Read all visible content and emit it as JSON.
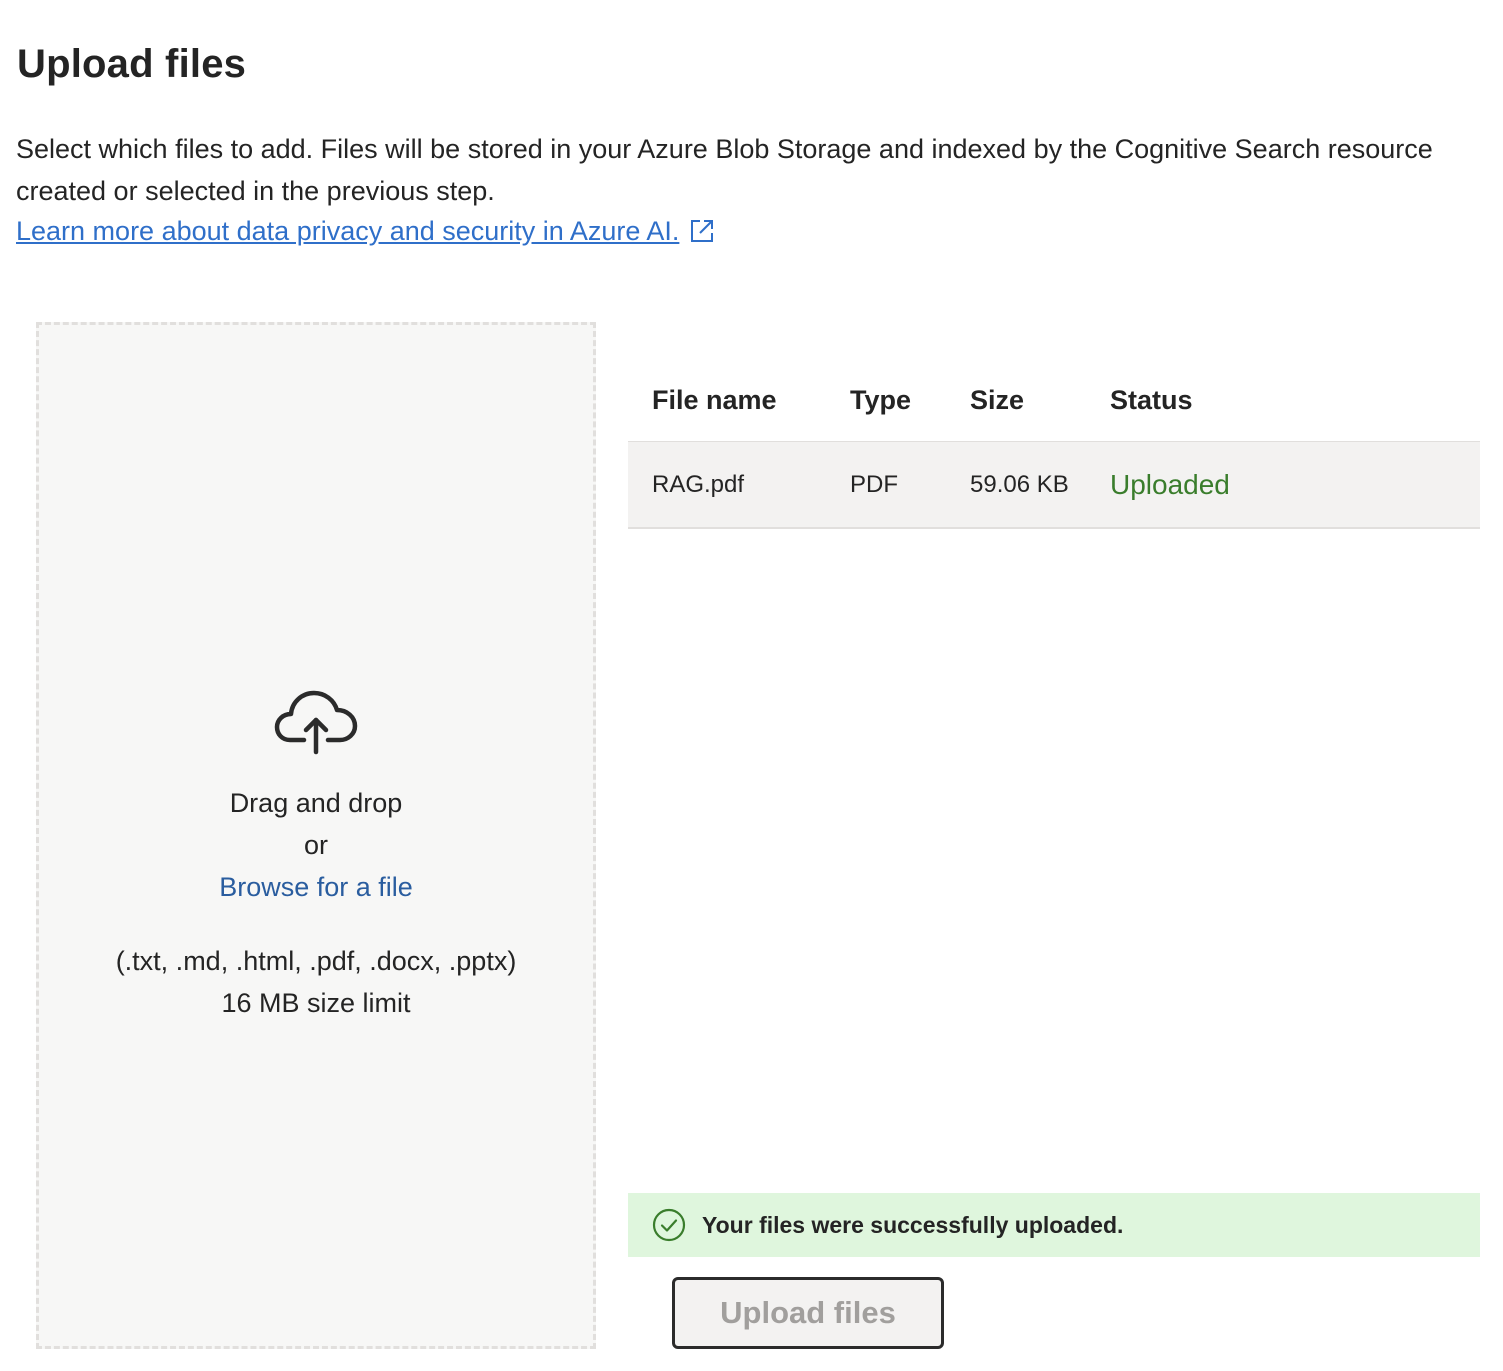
{
  "page": {
    "title": "Upload files",
    "description": "Select which files to add. Files will be stored in your Azure Blob Storage and indexed by the Cognitive Search resource created or selected in the previous step.",
    "learn_more_link": "Learn more about data privacy and security in Azure AI."
  },
  "dropzone": {
    "icon": "cloud-upload-icon",
    "drag_text": "Drag and drop",
    "or_text": "or",
    "browse_text": "Browse for a file",
    "formats_text": "(.txt, .md, .html, .pdf, .docx, .pptx)",
    "limit_text": "16 MB size limit"
  },
  "table": {
    "columns": [
      "File name",
      "Type",
      "Size",
      "Status"
    ],
    "rows": [
      {
        "name": "RAG.pdf",
        "type": "PDF",
        "size": "59.06 KB",
        "status": "Uploaded"
      }
    ]
  },
  "success_message": {
    "icon": "check-circle-icon",
    "text": "Your files were successfully uploaded."
  },
  "actions": {
    "upload_label": "Upload files"
  },
  "colors": {
    "link": "#2f6fc9",
    "browse": "#2a5d9f",
    "status_success": "#3a7d2c",
    "success_bg": "#dff6dd",
    "dropzone_bg": "#f7f7f6"
  }
}
